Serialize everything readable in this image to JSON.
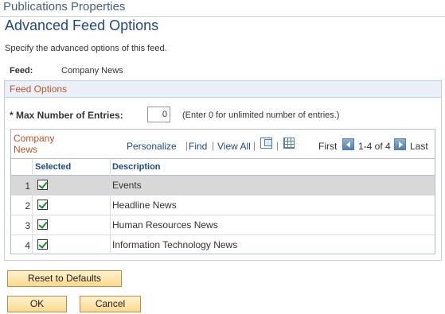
{
  "header": {
    "breadcrumb": "Publications Properties",
    "title": "Advanced Feed Options"
  },
  "instructions": "Specify the advanced options of this feed.",
  "feed": {
    "label": "Feed:",
    "value": "Company News"
  },
  "group": {
    "title": "Feed Options"
  },
  "max_entries": {
    "label": "* Max Number of Entries:",
    "value": "0",
    "hint": "(Enter 0 for unlimited number of entries.)"
  },
  "grid": {
    "title": "Company News",
    "personalize": "Personalize",
    "find": "Find",
    "view_all": "View All",
    "separator": "|",
    "first": "First",
    "range": "1-4 of 4",
    "last": "Last",
    "columns": {
      "selected": "Selected",
      "description": "Description"
    },
    "rows": [
      {
        "num": "1",
        "checked": true,
        "description": "Events"
      },
      {
        "num": "2",
        "checked": true,
        "description": "Headline News"
      },
      {
        "num": "3",
        "checked": true,
        "description": "Human Resources News"
      },
      {
        "num": "4",
        "checked": true,
        "description": "Information Technology News"
      }
    ]
  },
  "buttons": {
    "reset": "Reset to Defaults",
    "ok": "OK",
    "cancel": "Cancel"
  },
  "icons": {
    "zoom": "zoom-grid-icon",
    "download": "download-excel-icon",
    "prev": "prev-arrow-icon",
    "next": "next-arrow-icon",
    "check": "checkbox-checked-icon"
  }
}
